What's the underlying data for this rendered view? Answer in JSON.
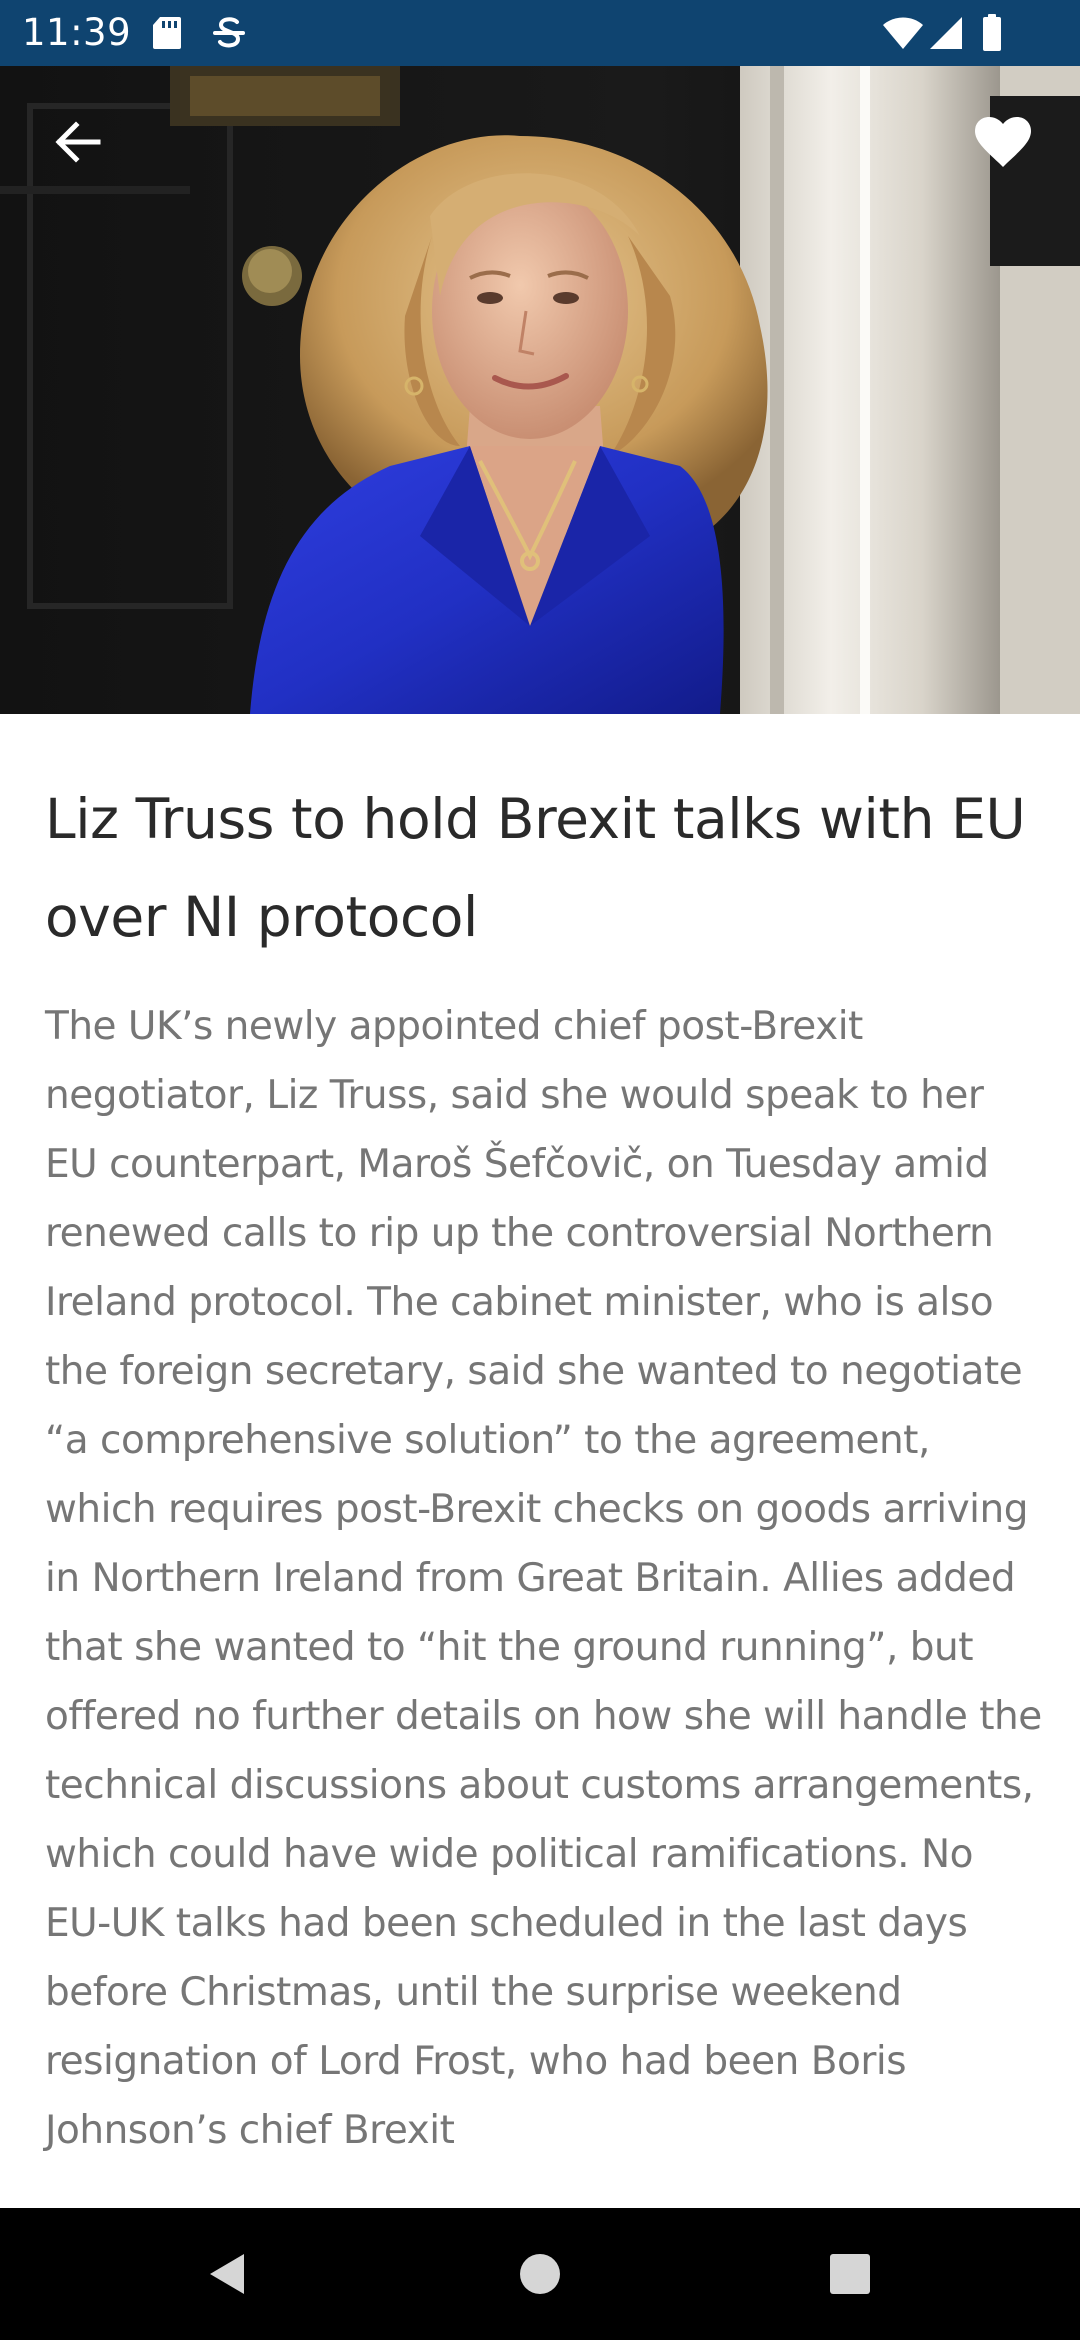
{
  "status_bar": {
    "time": "11:39",
    "left_icons": [
      "sd-card-icon",
      "s-app-icon"
    ],
    "right_icons": [
      "wifi-icon",
      "signal-icon",
      "battery-icon"
    ],
    "background_color": "#0f4470"
  },
  "toolbar": {
    "back_icon": "arrow-left-icon",
    "favorite_icon": "heart-icon"
  },
  "article": {
    "title": "Liz Truss to hold Brexit talks with EU over NI protocol",
    "body": "The UK’s newly appointed chief post-Brexit negotiator, Liz Truss, said she would speak to her EU counterpart, Maroš Šefčovič, on Tuesday amid renewed calls to rip up the controversial Northern Ireland protocol. The cabinet minister, who is also the foreign secretary, said she wanted to negotiate “a comprehensive solution” to the agreement, which requires post-Brexit checks on goods arriving in Northern Ireland from Great Britain. Allies added that she wanted to “hit the ground running”, but offered no further details on how she will handle the technical discussions about customs arrangements, which could have wide political ramifications. No EU-UK talks had been scheduled in the last days before Christmas, until the surprise weekend resignation of Lord Frost, who had been Boris Johnson’s chief Brexit"
  },
  "nav_bar": {
    "buttons": [
      "nav-back-icon",
      "nav-home-icon",
      "nav-recents-icon"
    ]
  }
}
